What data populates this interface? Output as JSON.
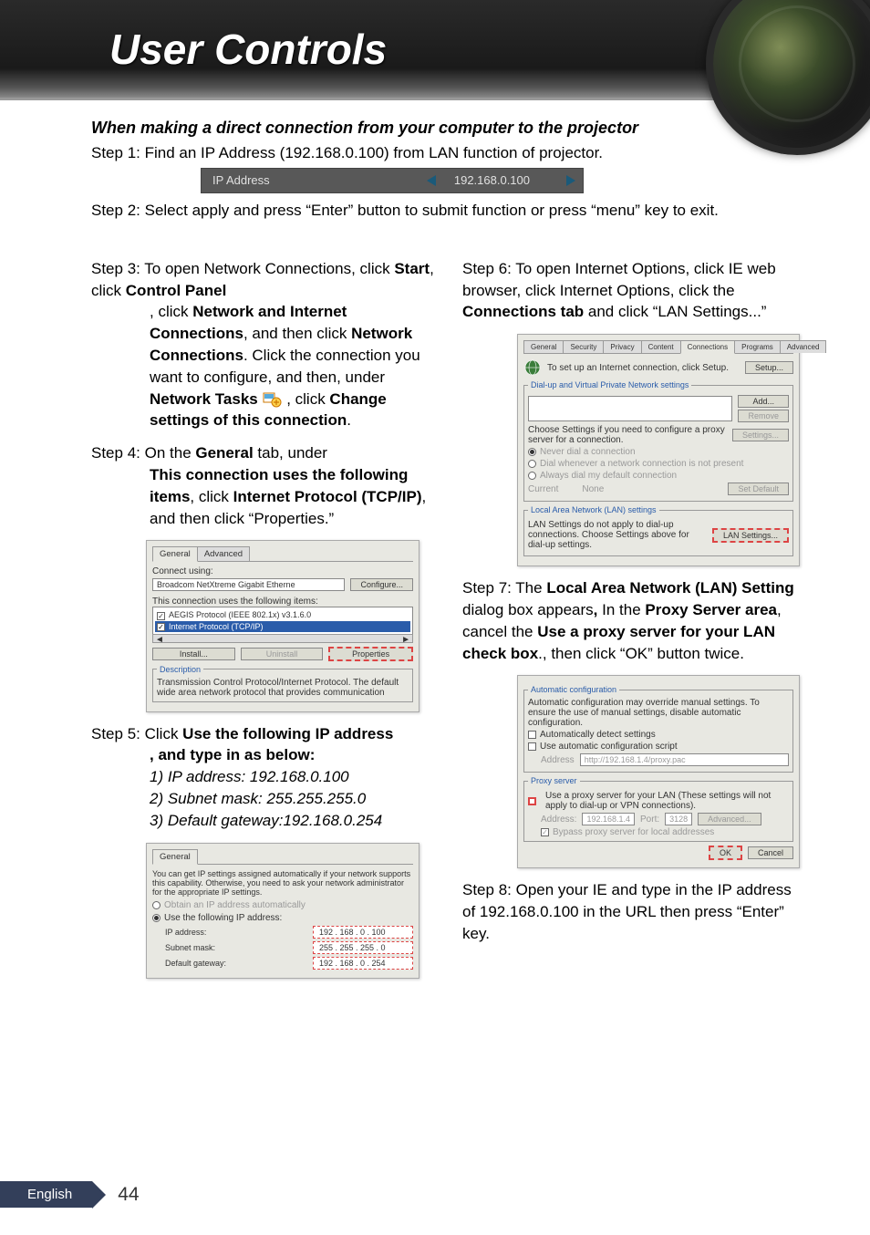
{
  "page": {
    "title": "User Controls",
    "section_heading": "When making a direct connection from your computer to the projector",
    "footer_language": "English",
    "page_number": "44"
  },
  "step1": {
    "label": "Step 1: ",
    "text": "Find an IP Address (192.168.0.100) from LAN function of projector."
  },
  "ip_bar": {
    "label": "IP Address",
    "value": "192.168.0.100"
  },
  "step2": {
    "label": "Step 2: ",
    "text": "Select apply and press “Enter” button to submit function or press “menu” key to exit."
  },
  "step3": {
    "label": "Step 3: ",
    "parts": {
      "a": "To open Network Connections, click ",
      "b_start": "Start",
      "c": ", click ",
      "d_cp": "Control Panel",
      "e": ", click ",
      "f_nic": "Network and Internet Connections",
      "g": ", and then click ",
      "h_nc": "Network Connections",
      "i": ". Click the connection you want to configure, and then, under ",
      "j_nt": "Network Tasks",
      "k_space": " ",
      "l": " , click ",
      "m_cs": "Change settings of this connection",
      "n": "."
    }
  },
  "step4": {
    "label": "Step 4: ",
    "parts": {
      "a": "On the ",
      "b": "General",
      "c": " tab, under ",
      "d": "This connection uses the following items",
      "e": ", click ",
      "f": "Internet Protocol (TCP/IP)",
      "g": ", and then click “Properties.”"
    }
  },
  "screenshot_general": {
    "tab_general": "General",
    "tab_advanced": "Advanced",
    "connect_using": "Connect using:",
    "adapter": "Broadcom NetXtreme Gigabit Etherne",
    "configure_btn": "Configure...",
    "uses_items": "This connection uses the following items:",
    "item1": "AEGIS Protocol (IEEE 802.1x) v3.1.6.0",
    "item2": "Internet Protocol (TCP/IP)",
    "install": "Install...",
    "uninstall": "Uninstall",
    "properties": "Properties",
    "desc_label": "Description",
    "desc_text": "Transmission Control Protocol/Internet Protocol. The default wide area network protocol that provides communication"
  },
  "step5": {
    "label": "Step 5: ",
    "parts": {
      "a": "Click ",
      "b": "Use the following IP address",
      "c": ", and type in as below:"
    },
    "line1": "1) IP address: 192.168.0.100",
    "line2": "2) Subnet mask: 255.255.255.0",
    "line3": "3) Default gateway:192.168.0.254"
  },
  "screenshot_ip": {
    "tab_general": "General",
    "intro": "You can get IP settings assigned automatically if your network supports this capability. Otherwise, you need to ask your network administrator for the appropriate IP settings.",
    "opt_auto": "Obtain an IP address automatically",
    "opt_manual": "Use the following IP address:",
    "ip_label": "IP address:",
    "ip_value": "192 . 168 .   0  . 100",
    "mask_label": "Subnet mask:",
    "mask_value": "255 . 255 . 255 .   0",
    "gw_label": "Default gateway:",
    "gw_value": "192 . 168 .   0  . 254"
  },
  "step6": {
    "label": "Step 6: ",
    "parts": {
      "a": "To open Internet Options, click IE web browser, click Internet Options, click the ",
      "b": "Connections tab",
      "c": " and click “LAN Settings...”"
    }
  },
  "screenshot_conn": {
    "tabs": [
      "General",
      "Security",
      "Privacy",
      "Content",
      "Connections",
      "Programs",
      "Advanced"
    ],
    "setup_text": "To set up an Internet connection, click Setup.",
    "setup_btn": "Setup...",
    "dialup_heading": "Dial-up and Virtual Private Network settings",
    "add_btn": "Add...",
    "remove_btn": "Remove",
    "choose_text": "Choose Settings if you need to configure a proxy server for a connection.",
    "settings_btn": "Settings...",
    "opt_never": "Never dial a connection",
    "opt_dial": "Dial whenever a network connection is not present",
    "opt_always": "Always dial my default connection",
    "current_label": "Current",
    "current_value": "None",
    "setdefault_btn": "Set Default",
    "lan_heading": "Local Area Network (LAN) settings",
    "lan_text": "LAN Settings do not apply to dial-up connections. Choose Settings above for dial-up settings.",
    "lan_btn": "LAN Settings..."
  },
  "step7": {
    "label": "Step 7: ",
    "parts": {
      "a": "The ",
      "b": "Local Area Network (LAN) Setting",
      "c": " dialog box appears",
      "comma": ",",
      "d": " In the ",
      "e": "Proxy Server area",
      "f": ", cancel the ",
      "g": "Use a proxy server for your LAN check box",
      "h": "., then click “OK” button twice."
    }
  },
  "screenshot_lan": {
    "auto_legend": "Automatic configuration",
    "auto_text": "Automatic configuration may override manual settings. To ensure the use of manual settings, disable automatic configuration.",
    "auto_detect": "Automatically detect settings",
    "auto_script": "Use automatic configuration script",
    "addr_label": "Address",
    "addr_value": "http://192.168.1.4/proxy.pac",
    "proxy_legend": "Proxy server",
    "proxy_use": "Use a proxy server for your LAN (These settings will not apply to dial-up or VPN connections).",
    "proxy_addr_label": "Address:",
    "proxy_addr": "192.168.1.4",
    "port_label": "Port:",
    "port": "3128",
    "advanced_btn": "Advanced...",
    "bypass": "Bypass proxy server for local addresses",
    "ok": "OK",
    "cancel": "Cancel"
  },
  "step8": {
    "label": "Step 8: ",
    "text": "Open your IE and type in the IP address of 192.168.0.100 in the URL then press “Enter” key."
  }
}
